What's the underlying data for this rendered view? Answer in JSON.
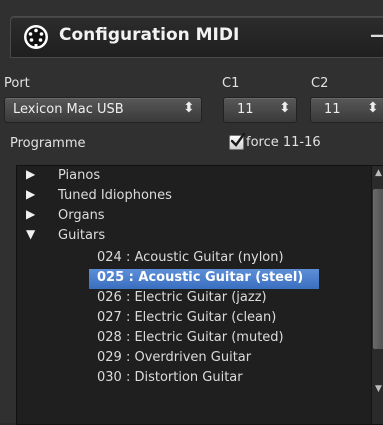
{
  "window": {
    "title": "Configuration MIDI",
    "minimize_symbol": "—"
  },
  "port": {
    "label": "Port",
    "selected": "Lexicon Mac USB",
    "c1_label": "C1",
    "c1_value": "11",
    "c2_label": "C2",
    "c2_value": "11"
  },
  "programme": {
    "label": "Programme",
    "force_label": "force 11-16",
    "force_checked": true
  },
  "list": {
    "categories": [
      {
        "label": "Pianos",
        "expanded": false
      },
      {
        "label": "Tuned Idiophones",
        "expanded": false
      },
      {
        "label": "Organs",
        "expanded": false
      },
      {
        "label": "Guitars",
        "expanded": true
      }
    ],
    "items": [
      "024 : Acoustic Guitar (nylon)",
      "025 : Acoustic Guitar (steel)",
      "026 : Electric Guitar (jazz)",
      "027 : Electric Guitar (clean)",
      "028 : Electric Guitar (muted)",
      "029 : Overdriven Guitar",
      "030 : Distortion Guitar"
    ],
    "selected_item": "025 : Acoustic Guitar (steel)"
  },
  "icons": {
    "logo": "midi-connector-icon",
    "collapsed": "triangle-right-icon",
    "expanded": "triangle-down-icon",
    "updown": "updown-arrows-icon",
    "check": "checkmark-icon"
  },
  "colors": {
    "background": "#303030",
    "list_background": "#1f1f1f",
    "selection": "#4a7fcc"
  }
}
